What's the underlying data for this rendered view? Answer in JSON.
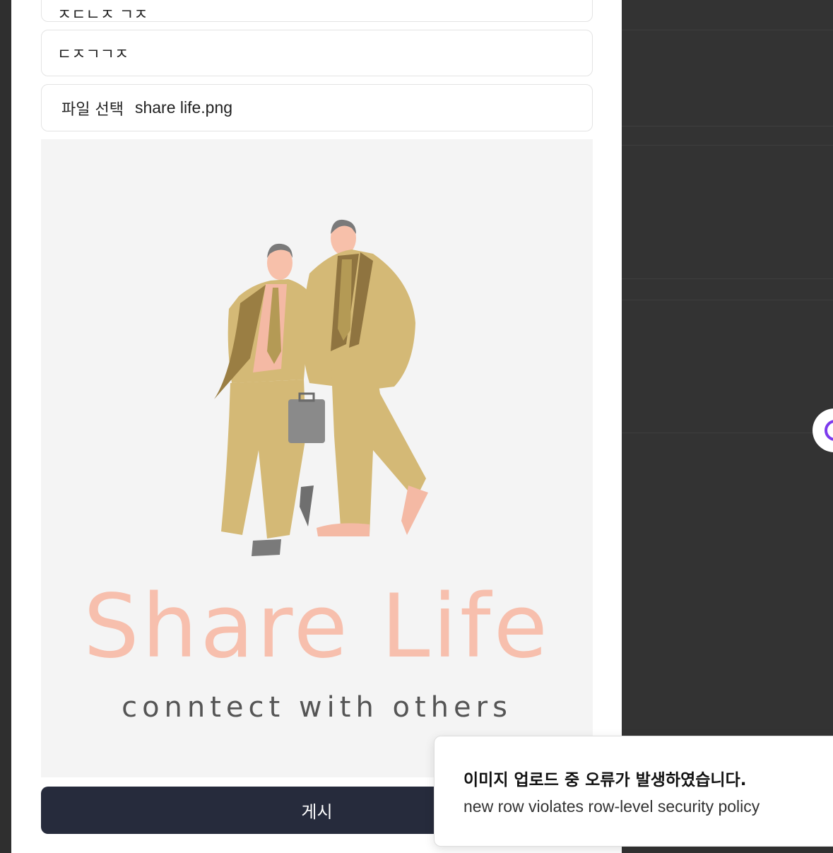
{
  "form": {
    "field_partial_value": "ㅈㄷㄴㅈ ㄱㅈ",
    "text_field_value": "ㄷㅈㄱㄱㅈ",
    "file_button_label": "파일 선택",
    "file_name": "share life.png"
  },
  "preview": {
    "logo_title": "Share Life",
    "logo_subtitle": "conntect with others"
  },
  "submit_label": "게시",
  "toast": {
    "title": "이미지 업로드 중 오류가 발생하였습니다.",
    "description": "new row violates row-level security policy"
  },
  "colors": {
    "backdrop": "#333333",
    "button": "#262b3c",
    "logo_pink": "#f7bfad",
    "suit": "#d4b976",
    "accent_purple": "#7c3aed"
  },
  "icons": {
    "floating_button": "circle-icon"
  }
}
